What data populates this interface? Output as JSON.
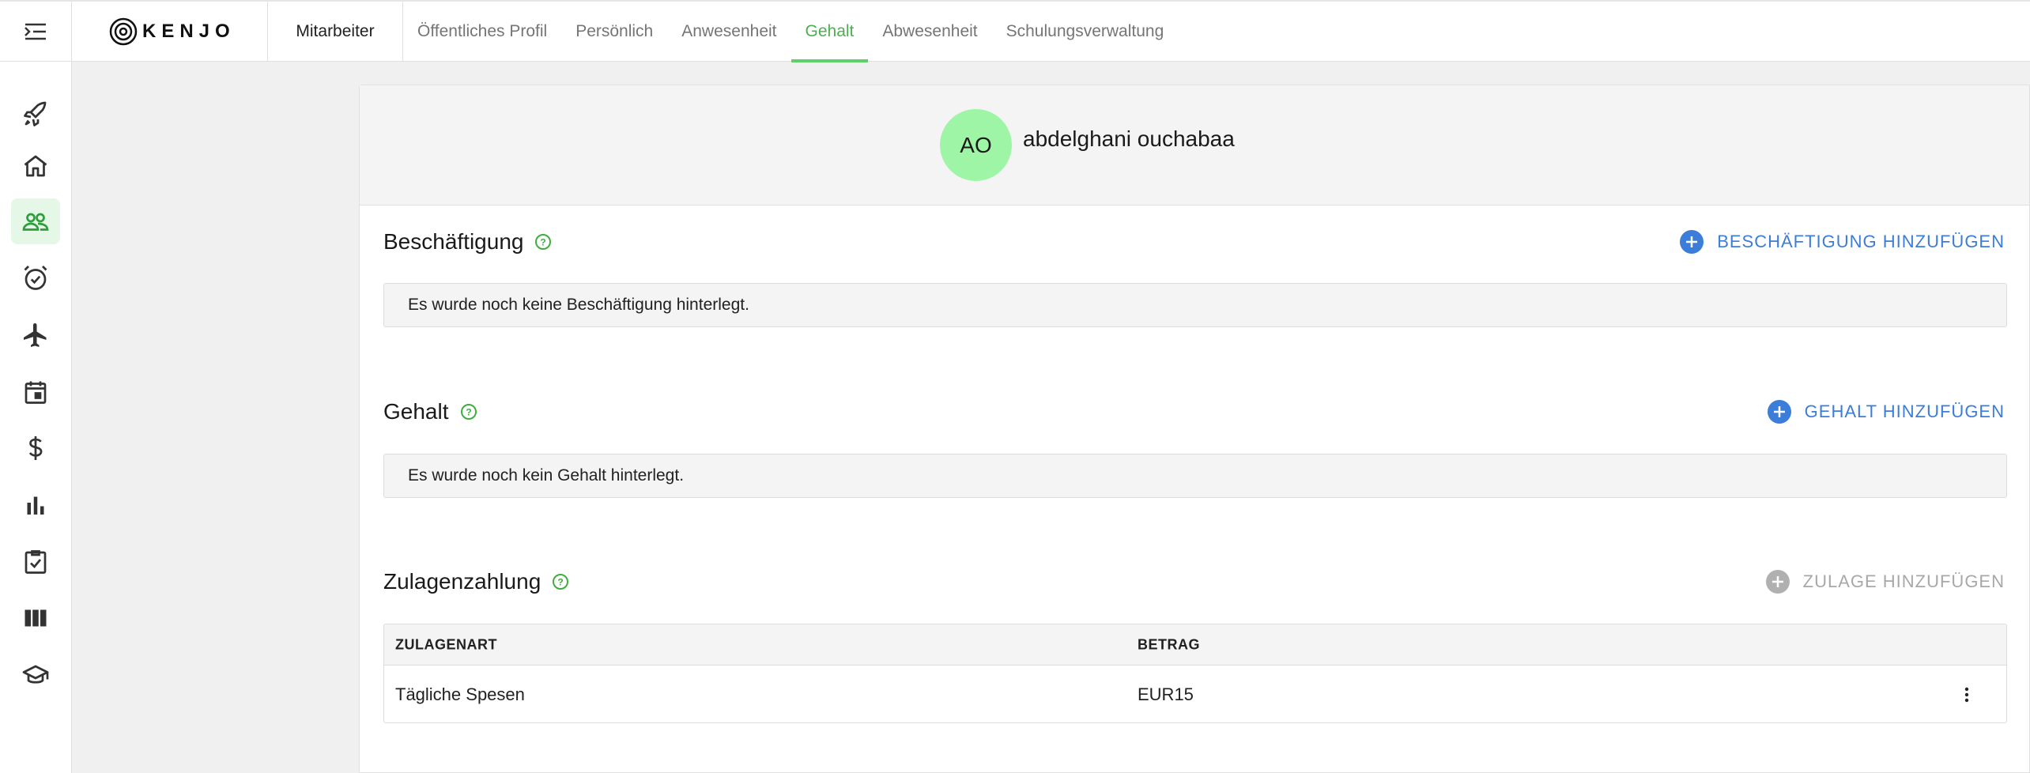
{
  "app": {
    "logo_text": "KENJO",
    "module": "Mitarbeiter"
  },
  "tabs": [
    {
      "label": "Öffentliches Profil"
    },
    {
      "label": "Persönlich"
    },
    {
      "label": "Anwesenheit"
    },
    {
      "label": "Gehalt",
      "active": true
    },
    {
      "label": "Abwesenheit"
    },
    {
      "label": "Schulungsverwaltung"
    }
  ],
  "sidebar": {
    "items": [
      {
        "icon": "rocket-icon"
      },
      {
        "icon": "home-icon"
      },
      {
        "icon": "people-icon",
        "active": true
      },
      {
        "icon": "alarm-clock-icon"
      },
      {
        "icon": "airplane-icon"
      },
      {
        "icon": "calendar-icon"
      },
      {
        "icon": "dollar-icon"
      },
      {
        "icon": "bar-chart-icon"
      },
      {
        "icon": "clipboard-check-icon"
      },
      {
        "icon": "columns-icon"
      },
      {
        "icon": "graduation-cap-icon"
      }
    ]
  },
  "profile": {
    "initials": "AO",
    "name": "abdelghani ouchabaa"
  },
  "employment": {
    "title": "Beschäftigung",
    "add_label": "BESCHÄFTIGUNG HINZUFÜGEN",
    "empty_text": "Es wurde noch keine Beschäftigung hinterlegt."
  },
  "salary": {
    "title": "Gehalt",
    "add_label": "GEHALT HINZUFÜGEN",
    "empty_text": "Es wurde noch kein Gehalt hinterlegt."
  },
  "allowance": {
    "title": "Zulagenzahlung",
    "add_label": "ZULAGE HINZUFÜGEN",
    "columns": [
      "ZULAGENART",
      "BETRAG"
    ],
    "rows": [
      {
        "type": "Tägliche Spesen",
        "amount": "EUR15"
      }
    ]
  },
  "colors": {
    "accent_green": "#5fd068",
    "link_blue": "#3b7dd8",
    "avatar_bg": "#9ef5a5",
    "disabled": "#a8a8a8"
  }
}
